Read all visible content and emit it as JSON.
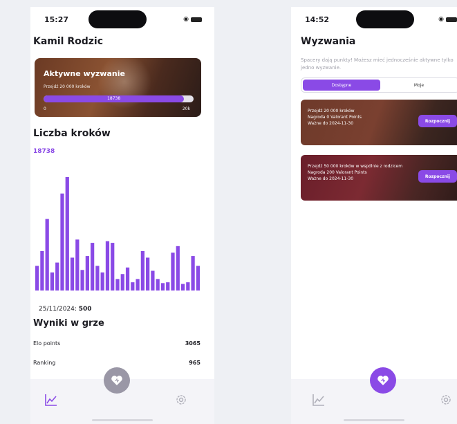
{
  "left_screen": {
    "status_time": "15:27",
    "user_name": "Kamil Rodzic",
    "active_challenge": {
      "title": "Aktywne wyzwanie",
      "description": "Przejdź 20 000 kroków",
      "progress_value": "18738",
      "progress_fraction": 0.937,
      "min_label": "0",
      "max_label": "20k"
    },
    "steps_title": "Liczba kroków",
    "steps_value": "18738",
    "chart_caption_date": "25/11/2024:",
    "chart_caption_value": "500",
    "scores_title": "Wyniki w grze",
    "scores": [
      {
        "label": "Elo points",
        "value": "3065"
      },
      {
        "label": "Ranking",
        "value": "965"
      }
    ]
  },
  "right_screen": {
    "status_time": "14:52",
    "title": "Wyzwania",
    "subtitle": "Spacery dają punkty! Możesz mieć jednocześnie aktywne tylko jedno wyzwanie.",
    "segments": [
      "Dostępne",
      "Moje"
    ],
    "selected_segment": "Dostępne",
    "challenges": [
      {
        "lines": [
          "Przejdź 20 000 kroków",
          "Nagroda 0 Valorant Points",
          "Ważne do 2024-11-30"
        ],
        "button": "Rozpocznij"
      },
      {
        "lines": [
          "Przejdź 50 000 kroków w wspólnie z rodzicem",
          "Nagroda 200 Valorant Points",
          "Ważne do 2024-11-30"
        ],
        "button": "Rozpocznij"
      }
    ]
  },
  "tabbar": {
    "icons": [
      "chart-icon",
      "heart-icon",
      "gear-icon"
    ],
    "accent": "#8a4ae6",
    "inactive_fab": "#9a97a6"
  },
  "chart_data": {
    "type": "bar",
    "values": [
      30,
      48,
      87,
      22,
      34,
      118,
      138,
      40,
      62,
      25,
      42,
      58,
      30,
      22,
      60,
      58,
      14,
      20,
      28,
      10,
      14,
      48,
      40,
      24,
      14,
      9,
      10,
      46,
      54,
      8,
      10,
      42,
      30
    ],
    "color": "#8a4ae6"
  }
}
